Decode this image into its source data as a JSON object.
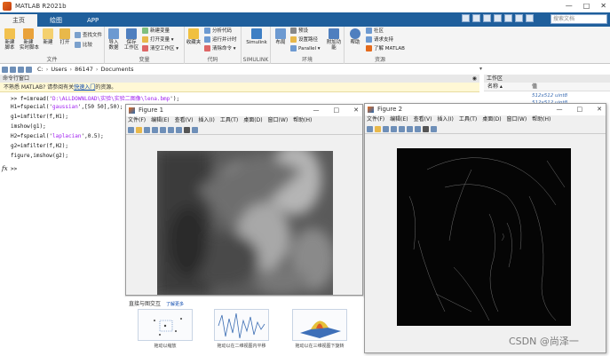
{
  "window": {
    "title": "MATLAB R2021b",
    "controls": [
      "—",
      "□",
      "✕"
    ]
  },
  "tabs": [
    {
      "label": "主页"
    },
    {
      "label": "绘图"
    },
    {
      "label": "APP"
    }
  ],
  "search": {
    "placeholder": "搜索文档"
  },
  "ribbon": {
    "groups": {
      "file": "文件",
      "variable": "变量",
      "code": "代码",
      "simulink": "SIMULINK",
      "env": "环境",
      "resources": "资源"
    },
    "buttons": {
      "new_script": "新建\n脚本",
      "new_live": "新建\n实时脚本",
      "new": "新建",
      "open": "打开",
      "find_files": "查找文件",
      "compare": "比较",
      "import": "导入\n数据",
      "save_ws": "保存\n工作区",
      "new_var": "新建变量",
      "open_var": "打开变量 ▾",
      "clear_ws": "清空工作区 ▾",
      "favorites": "收藏夹",
      "analyze": "分析代码",
      "run_time": "运行并计时",
      "clear_cmd": "清除命令 ▾",
      "simulink": "Simulink",
      "layout": "布局",
      "prefs": "预设",
      "set_path": "设置路径",
      "parallel": "Parallel ▾",
      "addons": "附加功能",
      "help": "帮助",
      "community": "社区",
      "support": "请求支持",
      "learn": "了解 MATLAB"
    }
  },
  "address": {
    "parts": [
      "C:",
      "Users",
      "86147",
      "Documents"
    ]
  },
  "command_window": {
    "header": "命令行窗口",
    "notice_text": "不熟悉 MATLAB? 请参阅有关",
    "notice_link": "快速入门",
    "notice_tail": "的资源。",
    "lines": [
      {
        "pre": ">> f=imread('",
        "str": "D:\\ALLDOWNLOAD\\实验\\实验二图像\\lena.bmp",
        "post": "');"
      },
      {
        "pre": "H1=fspecial('",
        "str": "gaussian",
        "post": "',[50 50],50);"
      },
      {
        "pre": "g1=imfilter(f,H1);",
        "str": "",
        "post": ""
      },
      {
        "pre": "imshow(g1);",
        "str": "",
        "post": ""
      },
      {
        "pre": "H2=fspecial('",
        "str": "laplacian",
        "post": "',0.5);"
      },
      {
        "pre": "g2=imfilter(f,H2);",
        "str": "",
        "post": ""
      },
      {
        "pre": "figure,imshow(g2);",
        "str": "",
        "post": ""
      }
    ],
    "prompt": "fx",
    "prompt_caret": ">>"
  },
  "workspace": {
    "header": "工作区",
    "col_name": "名称 ▴",
    "col_value": "值",
    "rows": [
      {
        "value": "512x512 uint8"
      },
      {
        "value": "512x512 uint8"
      }
    ]
  },
  "figure1": {
    "title": "Figure 1",
    "menu": [
      "文件(F)",
      "编辑(E)",
      "查看(V)",
      "插入(I)",
      "工具(T)",
      "桌面(D)",
      "窗口(W)",
      "帮助(H)"
    ]
  },
  "figure2": {
    "title": "Figure 2",
    "menu": [
      "文件(F)",
      "编辑(E)",
      "查看(V)",
      "插入(I)",
      "工具(T)",
      "桌面(D)",
      "窗口(W)",
      "帮助(H)"
    ]
  },
  "interactive": {
    "header": "直接与图交互",
    "link": "了解更多",
    "captions": [
      "拖动以缩放",
      "拖动以在二维视图内平移",
      "拖动以在三维视图下旋转"
    ]
  },
  "watermark": "CSDN @尚泽一",
  "colors": {
    "tab_bar": "#1f5f9c",
    "ribbon_bg": "#f4f4f4",
    "notice_bg": "#fff8d5",
    "string_purple": "#a020f0"
  }
}
